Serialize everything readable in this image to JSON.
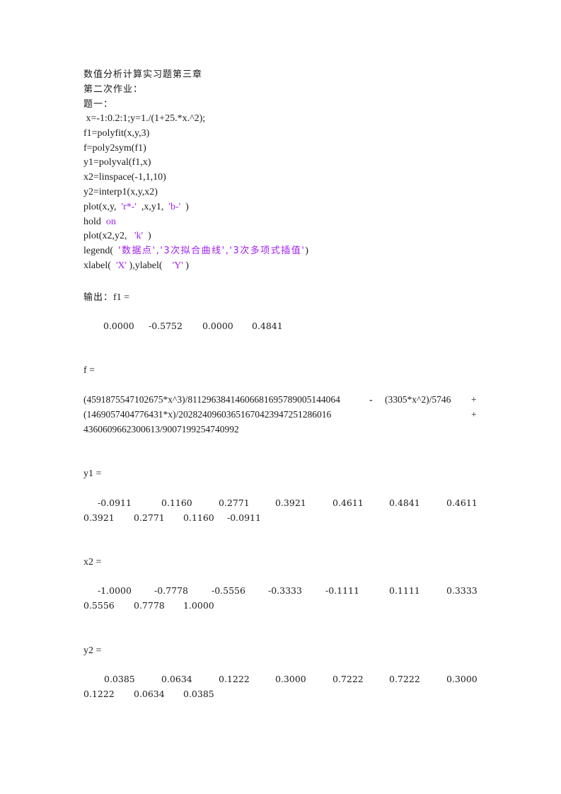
{
  "document": {
    "title": "数值分析计算实习题第三章",
    "subtitle": "第二次作业：",
    "problem_label": "题一：",
    "code": {
      "line1": " x=-1:0.2:1;y=1./(1+25.*x.^2);",
      "line2": "f1=polyfit(x,y,3)",
      "line3": "f=poly2sym(f1)",
      "line4": "y1=polyval(f1,x)",
      "line5": "x2=linspace(-1,1,10)",
      "line6": "y2=interp1(x,y,x2)",
      "plot1": {
        "prefix": "plot(x,y,  ",
        "str1": "'r*-'",
        "middle": "  ,x,y1,  ",
        "str2": "'b-'",
        "suffix": "  )"
      },
      "hold": {
        "keyword": "hold  ",
        "arg": "on"
      },
      "plot2": {
        "prefix": "plot(x2,y2,   ",
        "str1": "'k'",
        "suffix": "  )"
      },
      "legend": {
        "prefix": "legend(  ",
        "str1": "'数据点'",
        "sep1": ",",
        "str2": "'3次拟合曲线'",
        "sep2": ",",
        "str3": "'3次多项式插值'",
        "suffix": ")"
      },
      "labels": {
        "prefix": "xlabel(  ",
        "str1": "'X'",
        "middle": " ),ylabel(    ",
        "str2": "'Y'",
        "suffix": " )"
      }
    },
    "output_label": "输出：",
    "outputs": {
      "f1": {
        "label": "f1 =",
        "values": [
          "0.0000",
          "-0.5752",
          "0.0000",
          "0.4841"
        ]
      },
      "f": {
        "label": "f =",
        "expr_line1_a": "(4591875547102675*x^3)/81129638414606681695789005144064",
        "expr_line1_op": "-",
        "expr_line1_b": "(3305*x^2)/5746",
        "expr_line1_plus": "+",
        "expr_line2_a": "(1469057404776431*x)/20282409603651670423947251286016",
        "expr_line2_plus": "+",
        "expr_line3": "4360609662300613/9007199254740992"
      },
      "y1": {
        "label": "y1 =",
        "row1": [
          "-0.0911",
          "0.1160",
          "0.2771",
          "0.3921",
          "0.4611",
          "0.4841",
          "0.4611"
        ],
        "row2": [
          "0.3921",
          "0.2771",
          "0.1160",
          "-0.0911"
        ]
      },
      "x2": {
        "label": "x2 =",
        "row1": [
          "-1.0000",
          "-0.7778",
          "-0.5556",
          "-0.3333",
          "-0.1111",
          "0.1111",
          "0.3333"
        ],
        "row2": [
          "0.5556",
          "0.7778",
          "1.0000"
        ]
      },
      "y2": {
        "label": "y2 =",
        "row1": [
          "0.0385",
          "0.0634",
          "0.1222",
          "0.3000",
          "0.7222",
          "0.7222",
          "0.3000"
        ],
        "row2": [
          "0.1222",
          "0.0634",
          "0.0385"
        ]
      }
    },
    "colors": {
      "text": "#1a1a1a",
      "string_literal": "#a020f0"
    }
  }
}
